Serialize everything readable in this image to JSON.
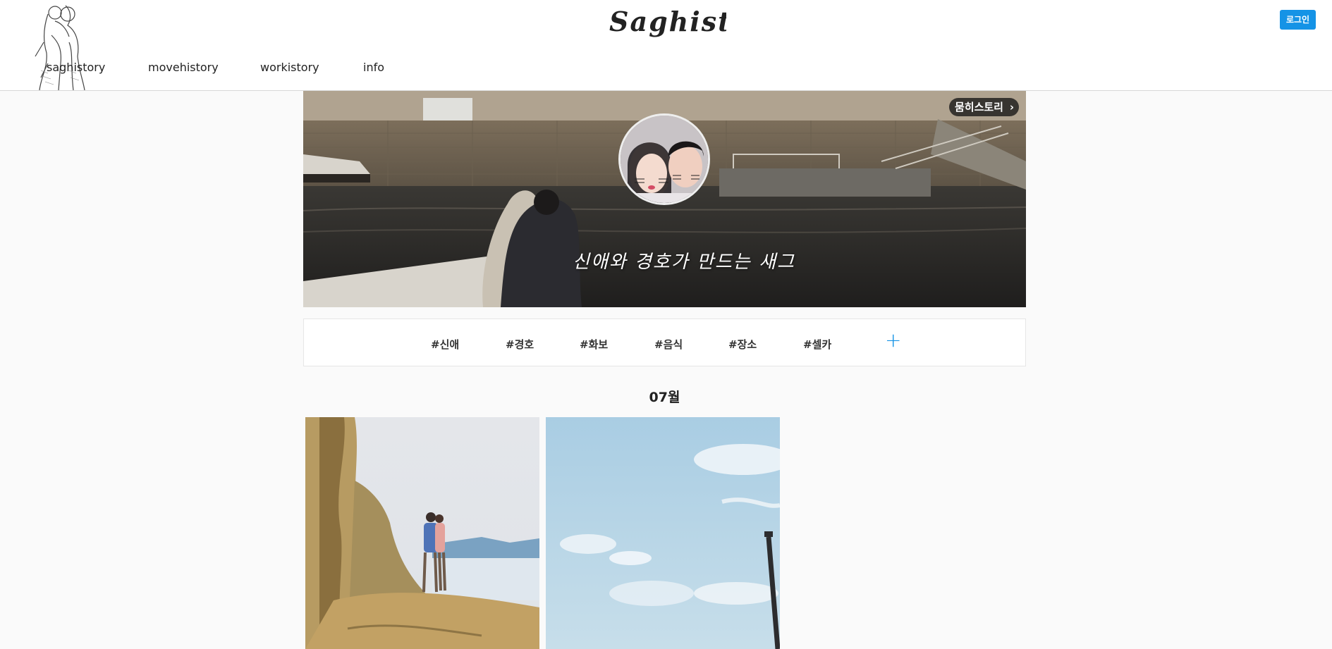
{
  "brand": {
    "logo_text": "Saghistory"
  },
  "header": {
    "login_label": "로그인",
    "nav": [
      "saghistory",
      "movehistory",
      "workistory",
      "info"
    ]
  },
  "hero": {
    "badge_label": "뭄히스토리",
    "caption": "신애와 경호가 만드는 새그"
  },
  "tags": [
    "#신애",
    "#경호",
    "#화보",
    "#음식",
    "#장소",
    "#셀카"
  ],
  "tag_add_label": "+",
  "gallery": {
    "month_label": "07월",
    "photos": [
      {
        "alt": "couple-on-rocks"
      },
      {
        "alt": "sky"
      }
    ]
  },
  "colors": {
    "accent": "#1593e6",
    "background": "#fafafa"
  },
  "icons": {
    "chevron": "chevron-right-icon",
    "plus": "plus-icon"
  }
}
